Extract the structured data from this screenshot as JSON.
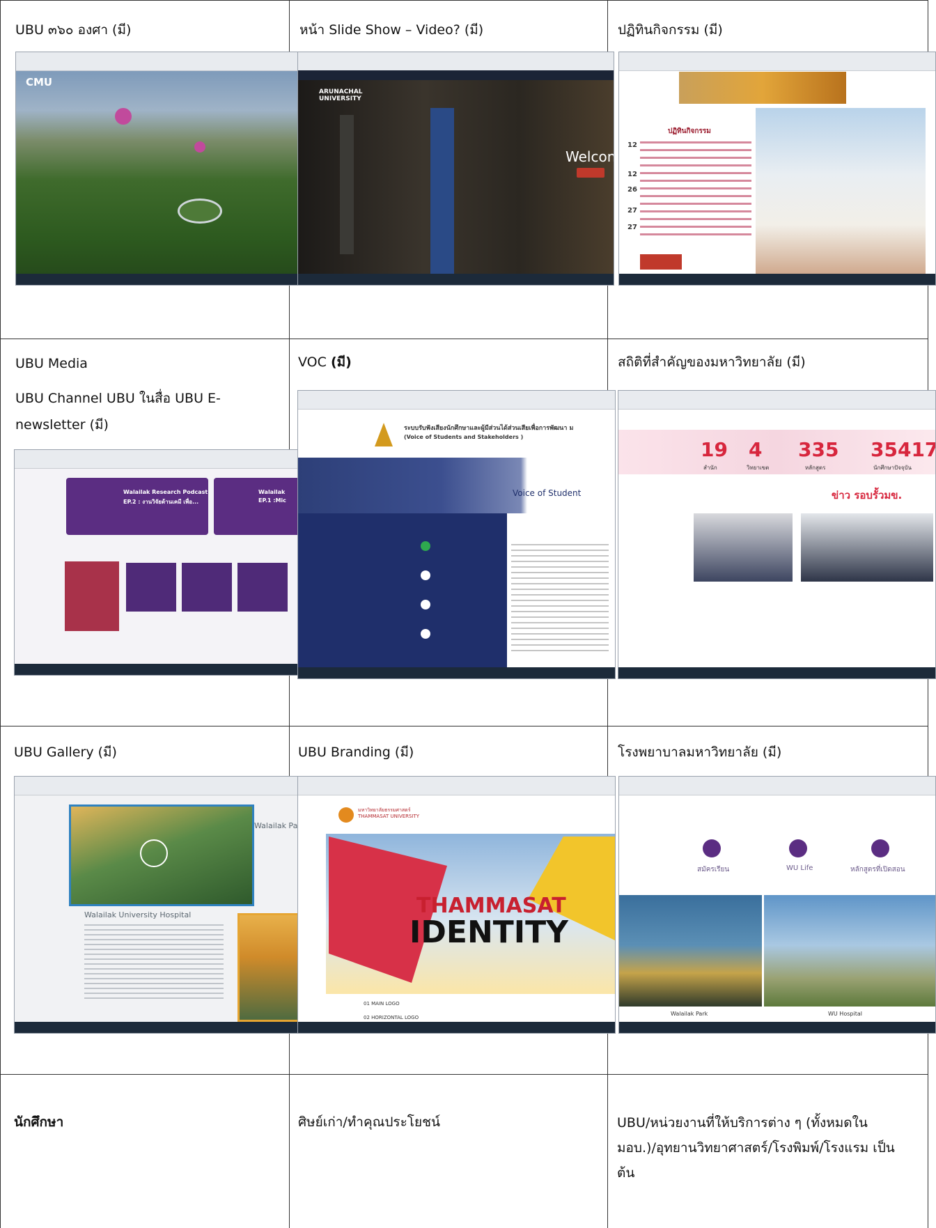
{
  "rows": [
    {
      "cells": [
        {
          "label": "UBU ๓๖๐ องศา (มี)"
        },
        {
          "label": "หน้า Slide Show – Video? (มี)"
        },
        {
          "label": "ปฏิทินกิจกรรม (มี)"
        }
      ]
    },
    {
      "cells": [
        {
          "label_line1": "UBU Media",
          "label_line2": "UBU Channel UBU ในสื่อ UBU E-",
          "label_line3": "newsletter (มี)"
        },
        {
          "label_pre": "VOC ",
          "label_bold": "(มี)"
        },
        {
          "label": "สถิติที่สำคัญของมหาวิทยาลัย (มี)"
        }
      ]
    },
    {
      "cells": [
        {
          "label": "UBU Gallery (มี)"
        },
        {
          "label": "UBU Branding (มี)"
        },
        {
          "label": "โรงพยาบาลมหาวิทยาลัย (มี)"
        }
      ]
    },
    {
      "cells": [
        {
          "label": "นักศึกษา"
        },
        {
          "label": "ศิษย์เก่า/ทำคุณประโยชน์"
        },
        {
          "label_line1": "UBU/หน่วยงานที่ให้บริการต่าง ๆ (ทั้งหมดใน",
          "label_line2": "มอบ.)/อุทยานวิทยาศาสตร์/โรงพิมพ์/โรงแรม เป็น",
          "label_line3": "ต้น"
        }
      ]
    }
  ],
  "screenshots": {
    "cmu": {
      "logo": "CMU"
    },
    "arunachal": {
      "logo_line1": "ARUNACHAL",
      "logo_line2": "UNIVERSITY",
      "welcome": "Welcon"
    },
    "calendar": {
      "heading": "ปฏิทินกิจกรรม",
      "days": [
        "12",
        "12",
        "26",
        "27",
        "27"
      ]
    },
    "media": {
      "podcast1": "Walailak Research Podcast",
      "podcast1_ep": "EP.2 : งานวิจัยด้านเคมี เพื่อ...",
      "podcast2": "Walailak",
      "podcast2_ep": "EP.1 :Mic"
    },
    "voc": {
      "title": "ระบบรับฟังเสียงนักศึกษาและผู้มีส่วนได้ส่วนเสียเพื่อการพัฒนา ม",
      "subtitle": "(Voice of Students and Stakeholders )",
      "banner": "Voice of Student"
    },
    "stats": {
      "values": [
        "19",
        "4",
        "335",
        "35417"
      ],
      "labels": [
        "สำนัก",
        "วิทยาเขต",
        "หลักสูตร",
        "นักศึกษาปัจจุบัน"
      ],
      "news": "ข่าว รอบรั้วมข."
    },
    "gallery": {
      "side_title": "Walailak Pa",
      "hospital": "Walailak University Hospital"
    },
    "branding": {
      "uni_line1": "มหาวิทยาลัยธรรมศาสตร์",
      "uni_line2": "THAMMASAT UNIVERSITY",
      "word1": "THAMMASAT",
      "word2": "IDENTITY",
      "caption1": "01 MAIN LOGO",
      "caption2": "02 HORIZONTAL LOGO"
    },
    "hospital": {
      "icons": [
        "สมัครเรียน",
        "WU Life",
        "หลักสูตรที่เปิดสอน"
      ],
      "captions": [
        "Walailak Park",
        "WU Hospital"
      ]
    }
  },
  "colors": {
    "grid": "#333333",
    "accent_red": "#d7263d",
    "purple": "#5b2d82",
    "navy": "#1f2f6b"
  }
}
